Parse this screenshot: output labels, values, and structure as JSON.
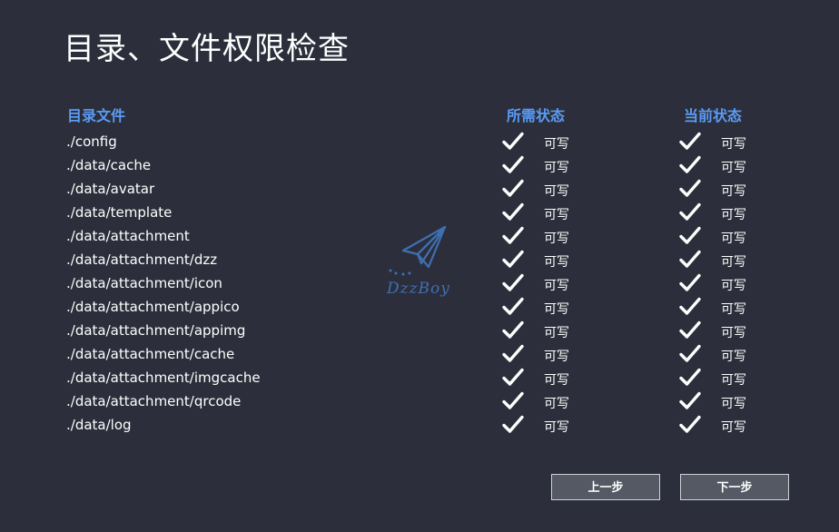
{
  "page": {
    "title": "目录、文件权限检查"
  },
  "table": {
    "headers": {
      "directory": "目录文件",
      "required": "所需状态",
      "current": "当前状态"
    },
    "rows": [
      {
        "path": "./config",
        "required": "可写",
        "current": "可写"
      },
      {
        "path": "./data/cache",
        "required": "可写",
        "current": "可写"
      },
      {
        "path": "./data/avatar",
        "required": "可写",
        "current": "可写"
      },
      {
        "path": "./data/template",
        "required": "可写",
        "current": "可写"
      },
      {
        "path": "./data/attachment",
        "required": "可写",
        "current": "可写"
      },
      {
        "path": "./data/attachment/dzz",
        "required": "可写",
        "current": "可写"
      },
      {
        "path": "./data/attachment/icon",
        "required": "可写",
        "current": "可写"
      },
      {
        "path": "./data/attachment/appico",
        "required": "可写",
        "current": "可写"
      },
      {
        "path": "./data/attachment/appimg",
        "required": "可写",
        "current": "可写"
      },
      {
        "path": "./data/attachment/cache",
        "required": "可写",
        "current": "可写"
      },
      {
        "path": "./data/attachment/imgcache",
        "required": "可写",
        "current": "可写"
      },
      {
        "path": "./data/attachment/qrcode",
        "required": "可写",
        "current": "可写"
      },
      {
        "path": "./data/log",
        "required": "可写",
        "current": "可写"
      }
    ]
  },
  "watermark": {
    "text": "DzzBoy",
    "icon": "paper-plane-icon"
  },
  "buttons": {
    "prev": "上一步",
    "next": "下一步"
  },
  "colors": {
    "background": "#2c2f3b",
    "accent": "#5b9bf5",
    "button_bg": "#555963",
    "watermark": "#3f6fb0"
  }
}
